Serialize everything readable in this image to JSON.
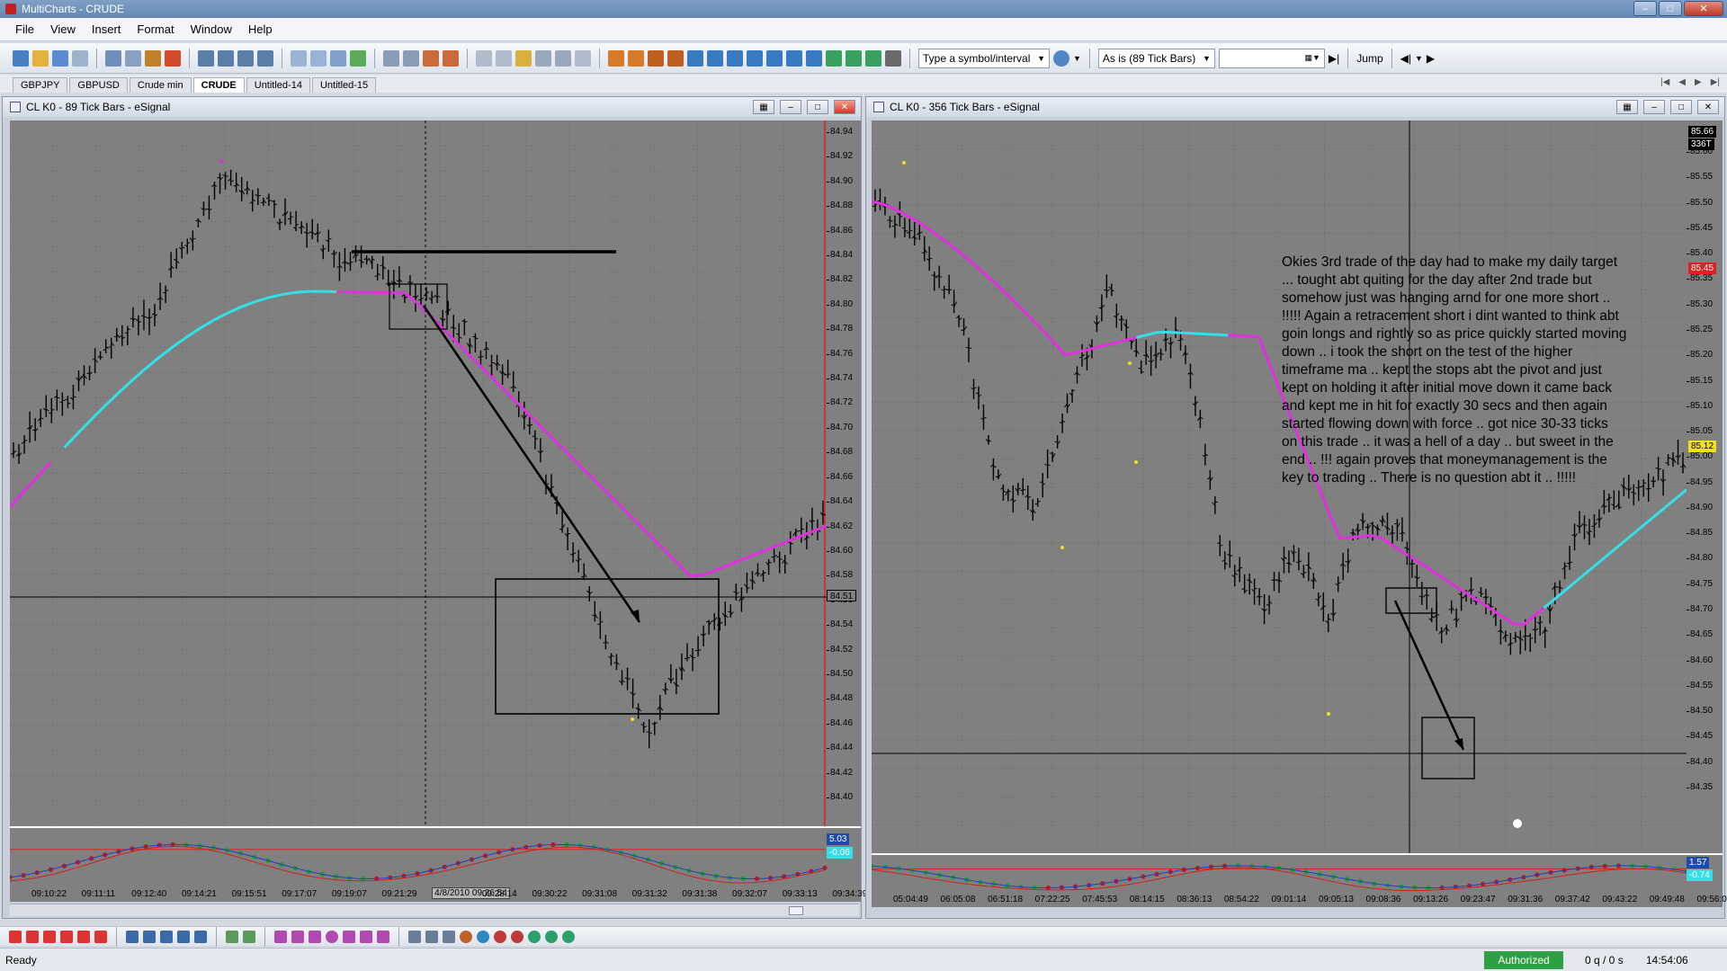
{
  "window": {
    "title": "MultiCharts - CRUDE"
  },
  "menu": [
    "File",
    "View",
    "Insert",
    "Format",
    "Window",
    "Help"
  ],
  "toolbar": {
    "symbol_placeholder": "Type a symbol/interval",
    "interval_select": "As is (89 Tick Bars)",
    "jump_label": "Jump"
  },
  "workspace_tabs": [
    "GBPJPY",
    "GBPUSD",
    "Crude min",
    "CRUDE",
    "Untitled-14",
    "Untitled-15"
  ],
  "active_tab": "CRUDE",
  "colors": {
    "ma_up": "#33e0e8",
    "ma_down": "#e030e0",
    "background": "#808080",
    "last_price": "#ffff00",
    "stop_line": "#ff3030"
  },
  "left_chart": {
    "title": "CL K0 - 89 Tick Bars - eSignal",
    "price_labels": [
      "84.94",
      "84.92",
      "84.90",
      "84.88",
      "84.86",
      "84.84",
      "84.82",
      "84.80",
      "84.78",
      "84.76",
      "84.74",
      "84.72",
      "84.70",
      "84.68",
      "84.66",
      "84.64",
      "84.62",
      "84.60",
      "84.58",
      "84.56",
      "84.54",
      "84.52",
      "84.50",
      "84.48",
      "84.46",
      "84.44",
      "84.42",
      "84.40"
    ],
    "cursor_price": "84.51",
    "time_labels": [
      "09:10:22",
      "09:11:11",
      "09:12:40",
      "09:14:21",
      "09:15:51",
      "09:17:07",
      "09:19:07",
      "09:21:29",
      "4/8/2010 09:26:54",
      "09:28:14",
      "09:30:22",
      "09:31:08",
      "09:31:32",
      "09:31:38",
      "09:32:07",
      "09:33:13",
      "09:34:39"
    ],
    "osc_badges": [
      "5.03",
      "-0.06"
    ]
  },
  "right_chart": {
    "title": "CL K0 - 356 Tick Bars - eSignal",
    "price_labels": [
      "85.60",
      "85.55",
      "85.50",
      "85.45",
      "85.40",
      "85.35",
      "85.30",
      "85.25",
      "85.20",
      "85.15",
      "85.10",
      "85.05",
      "85.00",
      "84.95",
      "84.90",
      "84.85",
      "84.80",
      "84.75",
      "84.70",
      "84.65",
      "84.60",
      "84.55",
      "84.50",
      "84.45",
      "84.40",
      "84.35"
    ],
    "top_badge": "85.66",
    "count_badge": "336T",
    "red_badge": "85.45",
    "yellow_badge": "85.12",
    "time_labels": [
      "05:04:49",
      "06:05:08",
      "06:51:18",
      "07:22:25",
      "07:45:53",
      "08:14:15",
      "08:36:13",
      "08:54:22",
      "09:01:14",
      "09:05:13",
      "09:08:36",
      "09:13:26",
      "09:23:47",
      "09:31:36",
      "09:37:42",
      "09:43:22",
      "09:49:48",
      "09:56:08"
    ],
    "osc_badges": [
      "1.57",
      "-0.74"
    ],
    "note": "Okies 3rd trade of the day had to make my daily target\n... tought abt quiting for the day after 2nd trade but\nsomehow just was hanging arnd for one more short ..\n!!!!! Again a retracement short i dint wanted to think abt\ngoin longs and rightly so as price quickly started moving\ndown .. i took the short on the test of the higher\ntimeframe ma .. kept the stops abt the pivot and just\nkept on holding it after initial move down it came back\nand kept me in hit for exactly 30 secs and then again\nstarted flowing down with force .. got nice 30-33 ticks\non this trade .. it was a hell of a day .. but sweet in the\nend .. !!! again proves that moneymanagement is the\nkey to trading .. There is no question abt it .. !!!!!"
  },
  "status": {
    "ready": "Ready",
    "authorized": "Authorized",
    "queue": "0 q / 0 s",
    "clock": "14:54:06"
  }
}
